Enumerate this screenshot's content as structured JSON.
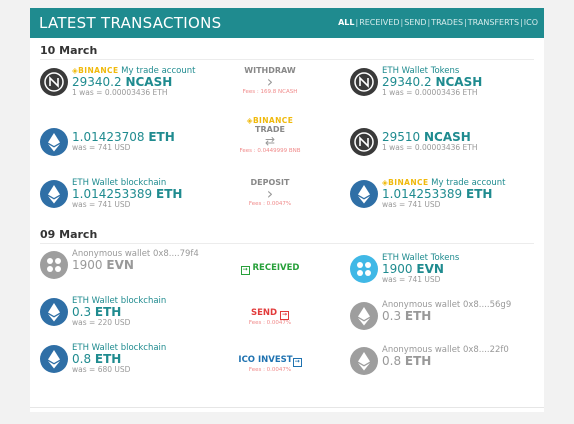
{
  "header": {
    "title": "LATEST TRANSACTIONS",
    "filters": [
      "ALL",
      "RECEIVED",
      "SEND",
      "TRADES",
      "TRANSFERTS",
      "ICO"
    ],
    "accent": "#1f8b8f"
  },
  "groups": [
    {
      "date": "10 March",
      "transactions": [
        {
          "from": {
            "icon": "ncash-icon",
            "exchange": "BINANCE",
            "name": "My trade account",
            "amount": "29340.2",
            "unit": "NCASH",
            "was": "1 was = 0.00003436 ETH"
          },
          "action": {
            "label": "WITHDRAW",
            "fees": "Fees : 169.8 NCASH"
          },
          "to": {
            "icon": "ncash-icon",
            "name": "ETH Wallet Tokens",
            "amount": "29340.2",
            "unit": "NCASH",
            "was": "1 was = 0.00003436 ETH"
          }
        },
        {
          "from": {
            "icon": "eth-icon",
            "amount": "1.01423708",
            "unit": "ETH",
            "was": "was = 741 USD"
          },
          "action": {
            "exchange": "BINANCE",
            "label": "TRADE",
            "fees": "Fees : 0.0449999 BNB"
          },
          "to": {
            "icon": "ncash-icon",
            "amount": "29510",
            "unit": "NCASH",
            "was": "1 was = 0.00003436 ETH"
          }
        },
        {
          "from": {
            "icon": "eth-icon",
            "name": "ETH Wallet blockchain",
            "amount": "1.014253389",
            "unit": "ETH",
            "was": "was = 741 USD"
          },
          "action": {
            "label": "DEPOSIT",
            "fees": "Fees : 0.0047%"
          },
          "to": {
            "icon": "eth-icon",
            "exchange": "BINANCE",
            "name": "My trade account",
            "amount": "1.014253389",
            "unit": "ETH",
            "was": "was = 741 USD"
          }
        }
      ]
    },
    {
      "date": "09 March",
      "transactions": [
        {
          "from": {
            "icon": "evn-icon",
            "name": "Anonymous wallet 0x8....79f4",
            "amount": "1900",
            "unit": "EVN"
          },
          "action": {
            "label": "RECEIVED"
          },
          "to": {
            "icon": "evn-icon",
            "name": "ETH Wallet Tokens",
            "amount": "1900",
            "unit": "EVN",
            "was": "was = 741 USD"
          }
        },
        {
          "from": {
            "icon": "eth-icon",
            "name": "ETH Wallet blockchain",
            "amount": "0.3",
            "unit": "ETH",
            "was": "was = 220 USD"
          },
          "action": {
            "label": "SEND",
            "fees": "Fees : 0.0047%"
          },
          "to": {
            "icon": "eth-icon",
            "name": "Anonymous wallet 0x8....56g9",
            "amount": "0.3",
            "unit": "ETH"
          }
        },
        {
          "from": {
            "icon": "eth-icon",
            "name": "ETH Wallet blockchain",
            "amount": "0.8",
            "unit": "ETH",
            "was": "was = 680 USD"
          },
          "action": {
            "label": "ICO INVEST",
            "fees": "Fees : 0.0047%"
          },
          "to": {
            "icon": "eth-icon",
            "name": "Anonymous wallet 0x8....22f0",
            "amount": "0.8",
            "unit": "ETH"
          }
        }
      ]
    }
  ]
}
